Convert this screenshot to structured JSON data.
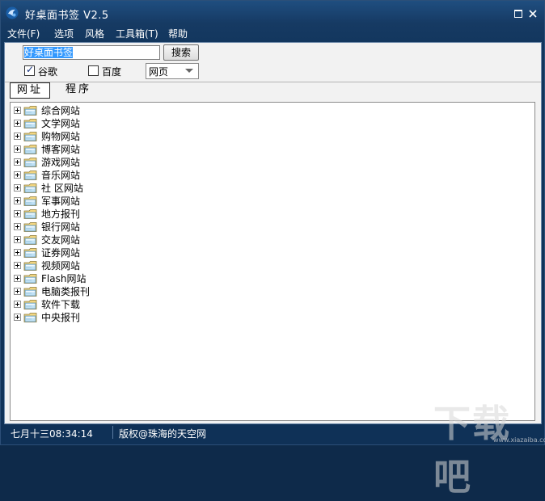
{
  "window": {
    "title": "好桌面书签 V2.5"
  },
  "menu": [
    "文件(F)",
    "选项",
    "风格",
    "工具箱(T)",
    "帮助"
  ],
  "search": {
    "value": "好桌面书签",
    "button_label": "搜索"
  },
  "engines": [
    {
      "label": "谷歌",
      "checked": true
    },
    {
      "label": "百度",
      "checked": false
    }
  ],
  "search_type": {
    "selected": "网页"
  },
  "tabs": [
    {
      "label": "网址",
      "active": true
    },
    {
      "label": "程序",
      "active": false
    }
  ],
  "tree": [
    "综合网站",
    "文学网站",
    "购物网站",
    "博客网站",
    "游戏网站",
    "音乐网站",
    "社 区网站",
    "军事网站",
    "地方报刊",
    "银行网站",
    "交友网站",
    "证券网站",
    "视频网站",
    "Flash网站",
    "电脑类报刊",
    "软件下载",
    "中央报刊"
  ],
  "status": {
    "time": "七月十三08:34:14",
    "copyright": "版权@珠海的天空网"
  },
  "watermark": {
    "text": "下载吧",
    "url": "www.xiazaiba.com"
  }
}
